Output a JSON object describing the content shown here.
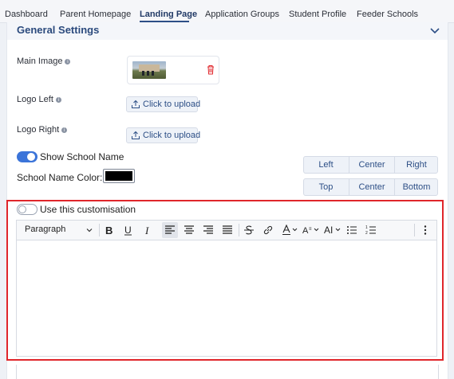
{
  "tabs": [
    {
      "label": "Dashboard"
    },
    {
      "label": "Parent Homepage"
    },
    {
      "label": "Landing Page"
    },
    {
      "label": "Application Groups"
    },
    {
      "label": "Student Profile"
    },
    {
      "label": "Feeder Schools"
    }
  ],
  "active_tab": "Landing Page",
  "section": {
    "title": "General Settings"
  },
  "fields": {
    "main_image": {
      "label": "Main Image"
    },
    "logo_left": {
      "label": "Logo Left",
      "button": "Click to upload"
    },
    "logo_right": {
      "label": "Logo Right",
      "button": "Click to upload"
    }
  },
  "show_school_name": {
    "label": "Show School Name",
    "enabled": true
  },
  "school_name_color": {
    "label": "School Name Color:",
    "value": "#000000"
  },
  "horizontal_align": [
    "Left",
    "Center",
    "Right"
  ],
  "vertical_align": [
    "Top",
    "Center",
    "Bottom"
  ],
  "customisation": {
    "label": "Use this customisation",
    "enabled": false
  },
  "editor": {
    "paragraph_select": "Paragraph",
    "tools": [
      "bold-icon",
      "underline-icon",
      "italic-icon",
      "align-left-icon",
      "align-center-icon",
      "align-right-icon",
      "align-justify-icon",
      "strikethrough-icon",
      "link-icon",
      "font-color-icon",
      "font-size-icon",
      "text-case-icon",
      "bulleted-list-icon",
      "numbered-list-icon",
      "more-options-icon"
    ],
    "content": ""
  },
  "colors": {
    "accent": "#3b74d9",
    "brand": "#2d4f86",
    "highlight": "#e0262b",
    "delete": "#e0262b"
  }
}
